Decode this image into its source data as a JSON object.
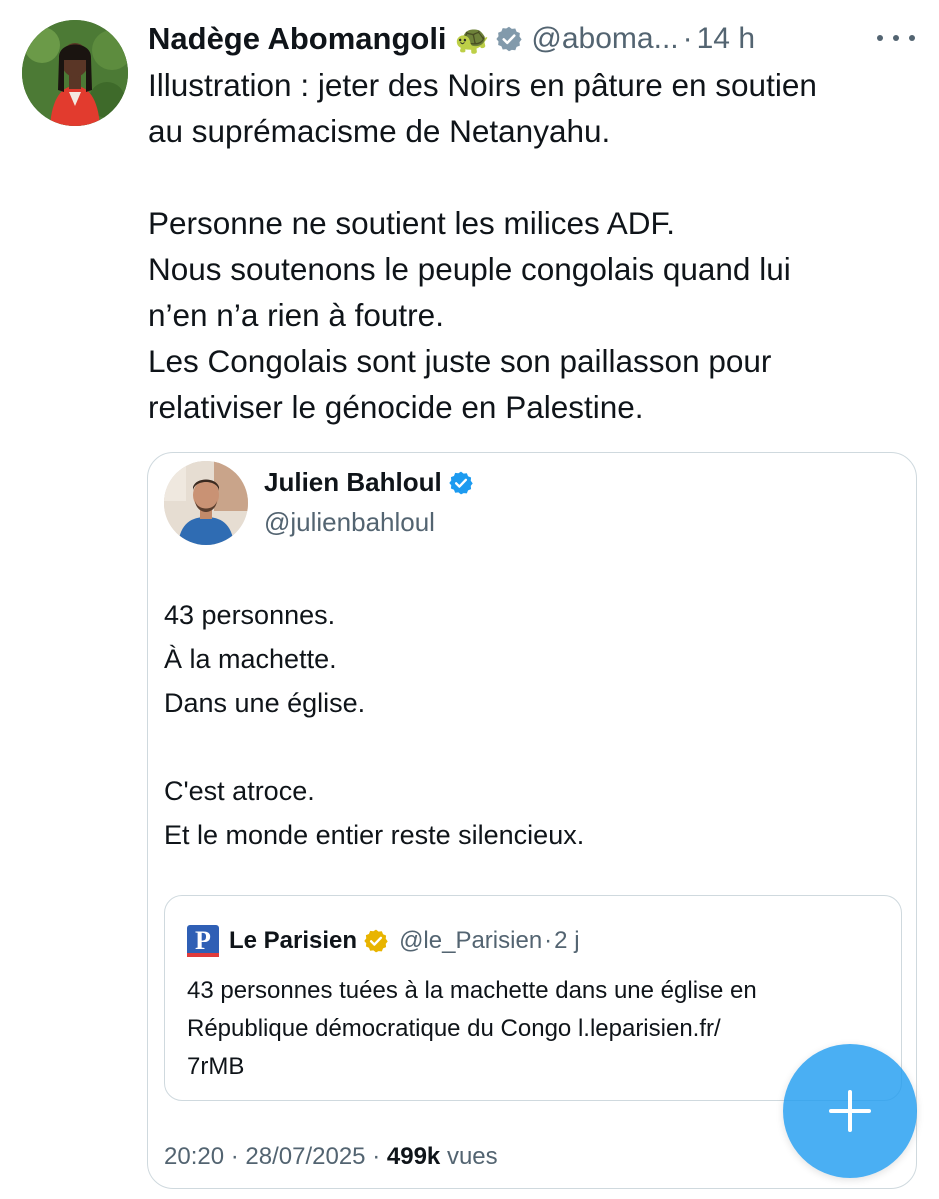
{
  "tweet": {
    "author_name": "Nadège Abomangoli",
    "author_emoji": "🐢",
    "handle": "@aboma...",
    "separator": "·",
    "time": "14 h",
    "body_lines": [
      "Illustration : jeter des Noirs en pâture en soutien",
      "au suprémacisme de Netanyahu.",
      "",
      "Personne ne soutient les milices ADF.",
      "Nous soutenons le peuple congolais quand lui",
      "n’en n’a rien à foutre.",
      "Les Congolais sont juste son paillasson pour",
      "relativiser le génocide en Palestine."
    ]
  },
  "quote": {
    "author_name": "Julien Bahloul",
    "handle": "@julienbahloul",
    "body_lines": [
      "43 personnes.",
      "À la machette.",
      "Dans une église.",
      "",
      "C'est atroce.",
      "Et le monde entier reste silencieux."
    ],
    "nested": {
      "logo_letter": "P",
      "author_name": "Le Parisien",
      "handle": "@le_Parisien",
      "separator": "·",
      "time": "2 j",
      "body_lines": [
        "43 personnes tuées à la machette dans une église en",
        "République démocratique du Congo l.leparisien.fr/",
        "7rMB"
      ]
    },
    "meta": {
      "time": "20:20",
      "separator1": "·",
      "date": "28/07/2025",
      "separator2": "·",
      "views_count": "499k",
      "views_label": "vues"
    }
  },
  "colors": {
    "accent_blue": "#1d9bf0",
    "muted_text": "#536471",
    "border": "#cfd9de",
    "gold_badge": "#e8b400",
    "grey_badge": "#829aab",
    "parisien_blue": "#2f5fb5",
    "parisien_red": "#e03b3b"
  },
  "icons": {
    "more": "more-horizontal-icon",
    "verified_grey": "verified-grey-badge-icon",
    "verified_blue": "verified-blue-badge-icon",
    "verified_gold": "verified-gold-badge-icon",
    "compose": "plus-icon"
  }
}
